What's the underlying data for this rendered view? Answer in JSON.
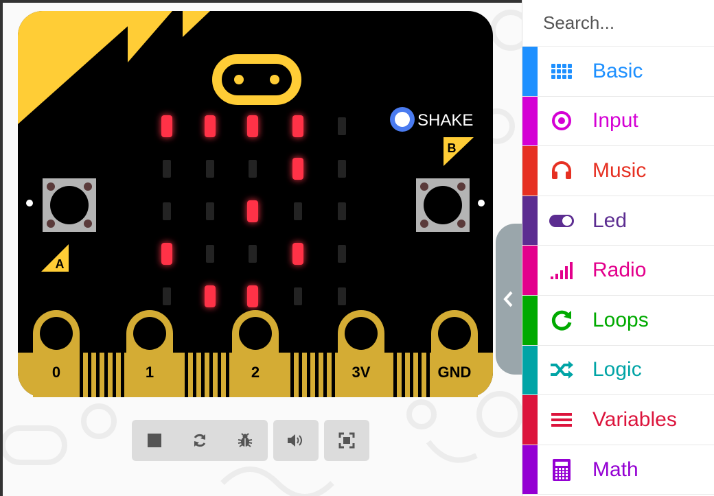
{
  "search": {
    "placeholder": "Search..."
  },
  "board": {
    "pin_labels": [
      "0",
      "1",
      "2",
      "3V",
      "GND"
    ],
    "button_a": "A",
    "button_b": "B",
    "shake_label": "SHAKE",
    "led_matrix": [
      [
        1,
        1,
        1,
        1,
        0
      ],
      [
        0,
        0,
        0,
        1,
        0
      ],
      [
        0,
        0,
        1,
        0,
        0
      ],
      [
        1,
        0,
        0,
        1,
        0
      ],
      [
        0,
        1,
        1,
        0,
        0
      ]
    ]
  },
  "controls": {
    "stop": "stop-icon",
    "restart": "restart-icon",
    "debug": "bug-icon",
    "mute": "volume-icon",
    "fullscreen": "fullscreen-icon"
  },
  "toolbox": {
    "categories": [
      {
        "label": "Basic",
        "color": "#1E90FF",
        "icon": "grid-icon"
      },
      {
        "label": "Input",
        "color": "#D400D4",
        "icon": "target-icon"
      },
      {
        "label": "Music",
        "color": "#E63022",
        "icon": "headphones-icon"
      },
      {
        "label": "Led",
        "color": "#5C2D91",
        "icon": "toggle-icon"
      },
      {
        "label": "Radio",
        "color": "#E3008C",
        "icon": "signal-bars-icon"
      },
      {
        "label": "Loops",
        "color": "#00AA00",
        "icon": "refresh-icon"
      },
      {
        "label": "Logic",
        "color": "#00A4A6",
        "icon": "shuffle-icon"
      },
      {
        "label": "Variables",
        "color": "#DC143C",
        "icon": "lines-icon"
      },
      {
        "label": "Math",
        "color": "#9400D3",
        "icon": "calculator-icon"
      }
    ]
  }
}
